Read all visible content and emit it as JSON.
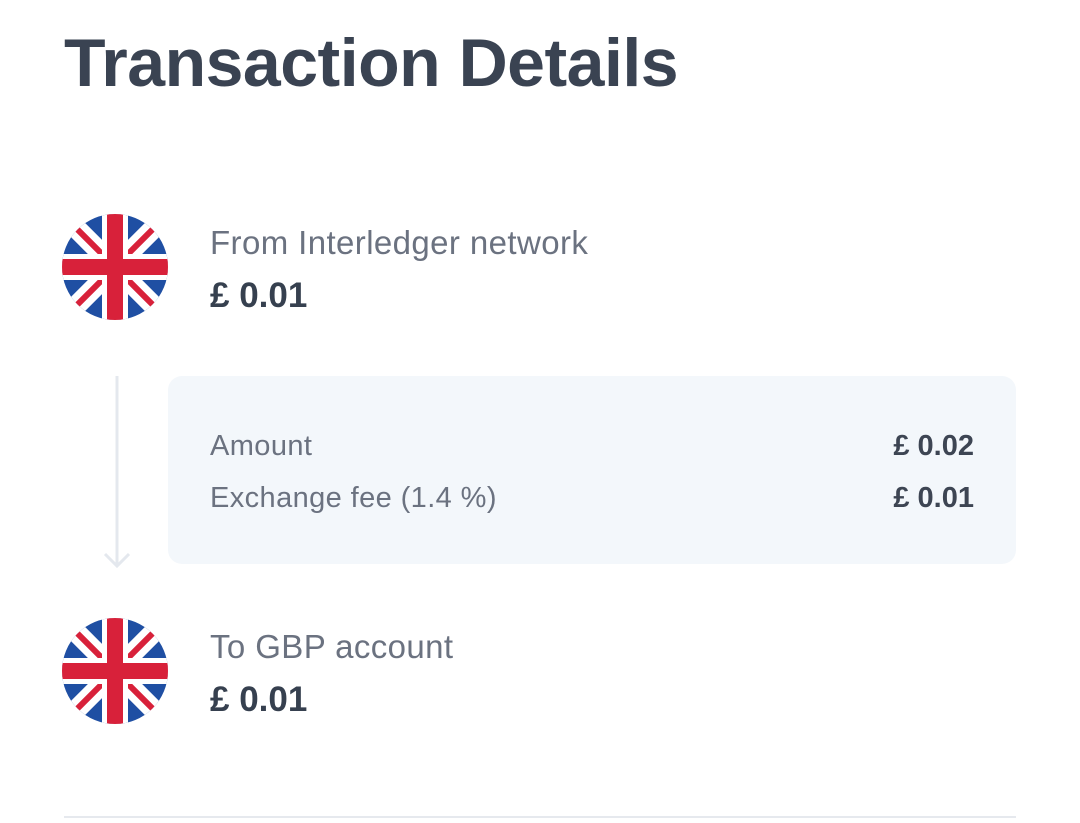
{
  "page": {
    "title": "Transaction Details"
  },
  "from": {
    "label": "From Interledger network",
    "amount": "£ 0.01",
    "flag_icon": "uk-flag-icon"
  },
  "breakdown": {
    "rows": [
      {
        "label": "Amount",
        "value": "£ 0.02"
      },
      {
        "label": "Exchange fee (1.4 %)",
        "value": "£ 0.01"
      }
    ]
  },
  "to": {
    "label": "To GBP account",
    "amount": "£ 0.01",
    "flag_icon": "uk-flag-icon"
  },
  "colors": {
    "flag_blue": "#1f4fa3",
    "flag_red": "#d8213a",
    "panel_bg": "#f3f7fb",
    "title_text": "#3a4352",
    "muted_text": "#6b7280"
  }
}
